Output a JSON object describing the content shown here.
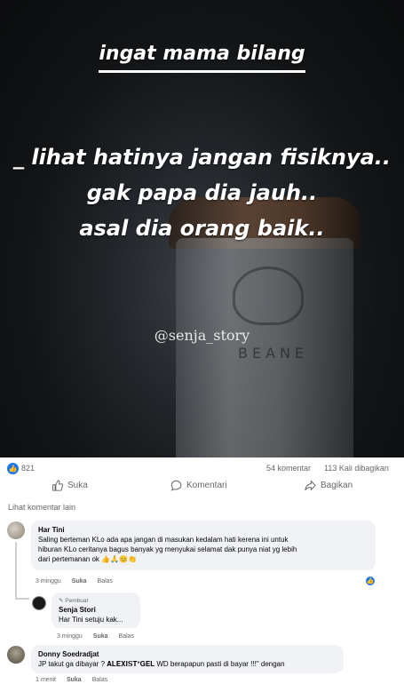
{
  "post": {
    "image": {
      "title": "ingat mama bilang",
      "line1": "_ lihat hatinya jangan fisiknya..",
      "line2": "gak papa dia jauh..",
      "line3": "asal dia orang baik..",
      "handle": "@senja_story",
      "cup_brand": "BEANE"
    },
    "reactions": {
      "like_count": "821",
      "comments": "54 komentar",
      "shares": "113 Kali dibagikan"
    },
    "actions": {
      "like": "Suka",
      "comment": "Komentari",
      "share": "Bagikan"
    },
    "view_more_comments": "Lihat komentar lain"
  },
  "comments": [
    {
      "name": "Har Tini",
      "text_lines": [
        "Saling berteman KLo ada apa jangan di masukan kedalam hati kerena ini untuk",
        "hiburan KLo ceritanya bagus banyak yg menyukai selamat dak punya niat yg lebih",
        "dari pertemanan ok 👍🙏😊👏"
      ],
      "time": "3 minggu",
      "like": "Suka",
      "reply": "Balas"
    },
    {
      "author_tag": "Pembuat",
      "name": "Senja Stori",
      "text": "Har Tini setuju kak...",
      "time": "3 minggu",
      "like": "Suka",
      "reply": "Balas"
    },
    {
      "name": "Donny Soedradjat",
      "text": "JP takut ga dibayar ? 𝐀𝐋𝐄𝐗𝐈𝐒𝐓*𝐆𝐄𝐋 WD berapapun pasti di bayar !!!\" dengan",
      "time": "1 menit",
      "like": "Suka",
      "reply": "Balas"
    }
  ],
  "colors": {
    "brand_blue": "#1877f2",
    "bubble_bg": "#f0f2f5",
    "muted_text": "#65676b"
  }
}
